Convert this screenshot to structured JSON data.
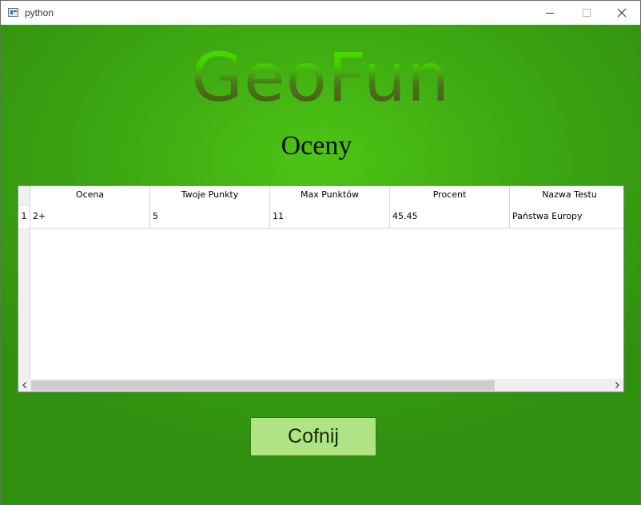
{
  "window": {
    "title": "python"
  },
  "app": {
    "logo_text": "GeoFun",
    "heading": "Oceny"
  },
  "table": {
    "columns": [
      "Ocena",
      "Twoje Punkty",
      "Max Punktów",
      "Procent",
      "Nazwa Testu"
    ],
    "row_numbers": [
      "1"
    ],
    "rows": [
      [
        "2+",
        "5",
        "11",
        "45.45",
        "Państwa Europy"
      ]
    ],
    "scroll_left_icon": "chevron-left",
    "scroll_right_icon": "chevron-right"
  },
  "buttons": {
    "back_label": "Cofnij"
  },
  "colors": {
    "background": "#3eaa12",
    "logo_top": "#46e000",
    "logo_bottom": "#4e4e1c",
    "button_bg": "#afe484"
  }
}
